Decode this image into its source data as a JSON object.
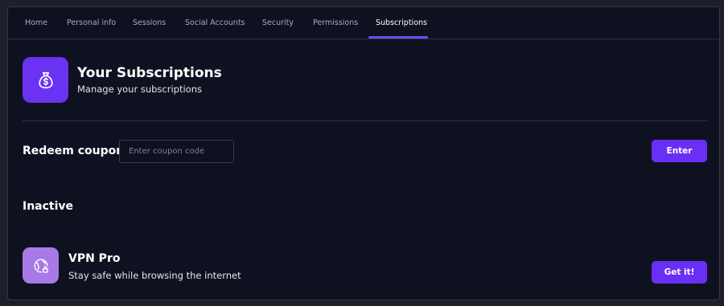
{
  "tabs": [
    {
      "label": "Home"
    },
    {
      "label": "Personal info"
    },
    {
      "label": "Sessions"
    },
    {
      "label": "Social Accounts"
    },
    {
      "label": "Security"
    },
    {
      "label": "Permissions"
    },
    {
      "label": "Subscriptions",
      "active": true
    }
  ],
  "header": {
    "title": "Your Subscriptions",
    "subtitle": "Manage your subscriptions",
    "icon": "money-bag-icon"
  },
  "redeem": {
    "label": "Redeem coupon",
    "placeholder": "Enter coupon code",
    "value": "",
    "button_label": "Enter"
  },
  "inactive": {
    "heading": "Inactive",
    "items": [
      {
        "name": "VPN Pro",
        "description": "Stay safe while browsing the internet",
        "icon": "globe-lock-icon",
        "button_label": "Get it!"
      }
    ]
  },
  "colors": {
    "background": "#0e1220",
    "accent": "#6a2ff5",
    "vpn_icon_bg": "#a77ae8"
  }
}
